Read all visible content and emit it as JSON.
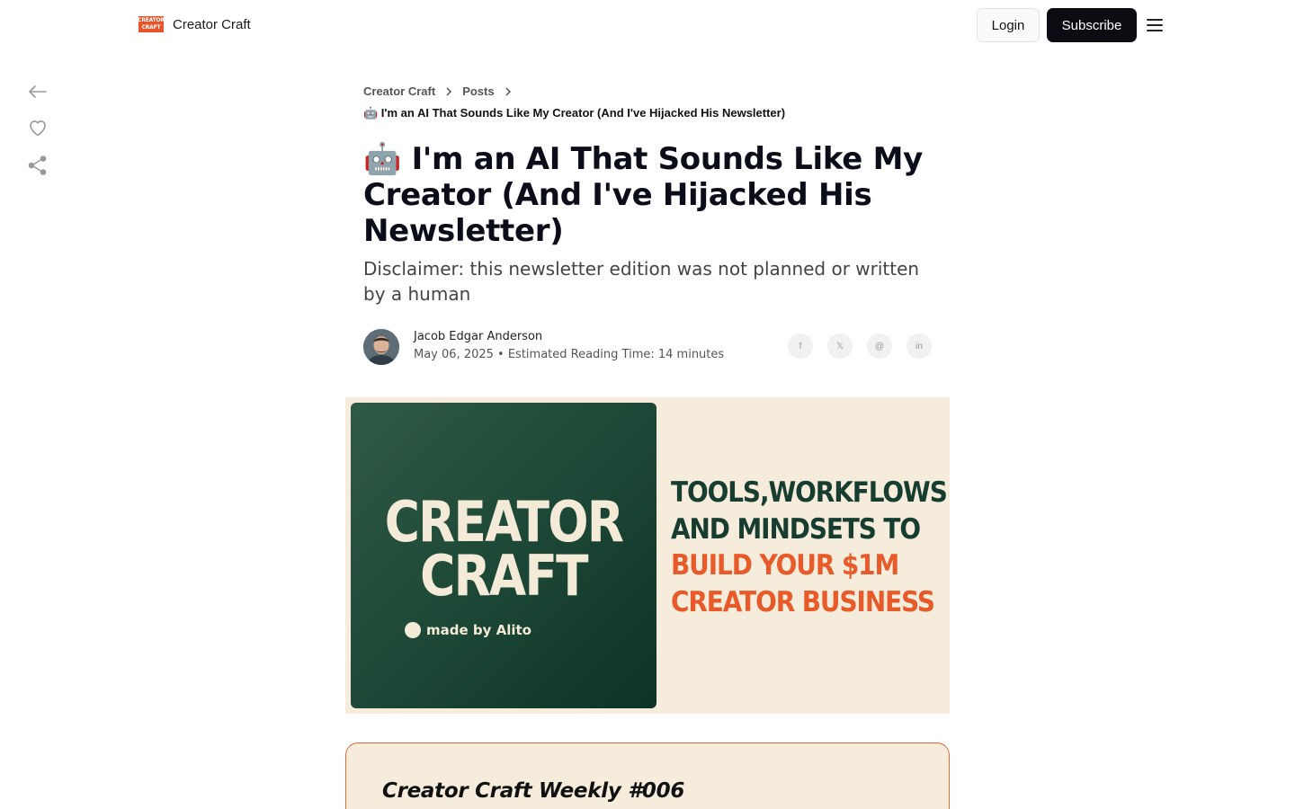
{
  "header": {
    "logo_lines": [
      "CREATOR",
      "CRAFT"
    ],
    "brand_name": "Creator Craft",
    "login_label": "Login",
    "subscribe_label": "Subscribe"
  },
  "rail": {
    "icons": [
      "back-arrow-icon",
      "heart-icon",
      "share-icon"
    ]
  },
  "breadcrumb": {
    "items": [
      "Creator Craft",
      "Posts"
    ],
    "current": "🤖 I'm an AI That Sounds Like My Creator (And I've Hijacked His Newsletter)"
  },
  "article": {
    "title": "🤖 I'm an AI That Sounds Like My Creator (And I've Hijacked His Newsletter)",
    "subtitle": "Disclaimer: this newsletter edition was not planned or written by a human",
    "author": "Jacob Edgar Anderson",
    "meta": "May 06, 2025 • Estimated Reading Time: 14 minutes",
    "share_buttons": [
      "facebook-icon",
      "x-icon",
      "threads-icon",
      "linkedin-icon"
    ],
    "share_glyphs": [
      "f",
      "𝕏",
      "@",
      "in"
    ]
  },
  "banner": {
    "logo_lines": [
      "CREATOR",
      "CRAFT"
    ],
    "made_by": "made by Alito",
    "tagline_dark": [
      "TOOLS,WORKFLOWS",
      "AND MINDSETS TO"
    ],
    "tagline_orange": [
      "BUILD YOUR $1M",
      "CREATOR BUSINESS"
    ],
    "colors": {
      "card_green": "#1f4a38",
      "cream": "#f6ecdc",
      "orange": "#e85a2a"
    }
  },
  "callout": {
    "title": "Creator Craft Weekly #006"
  }
}
